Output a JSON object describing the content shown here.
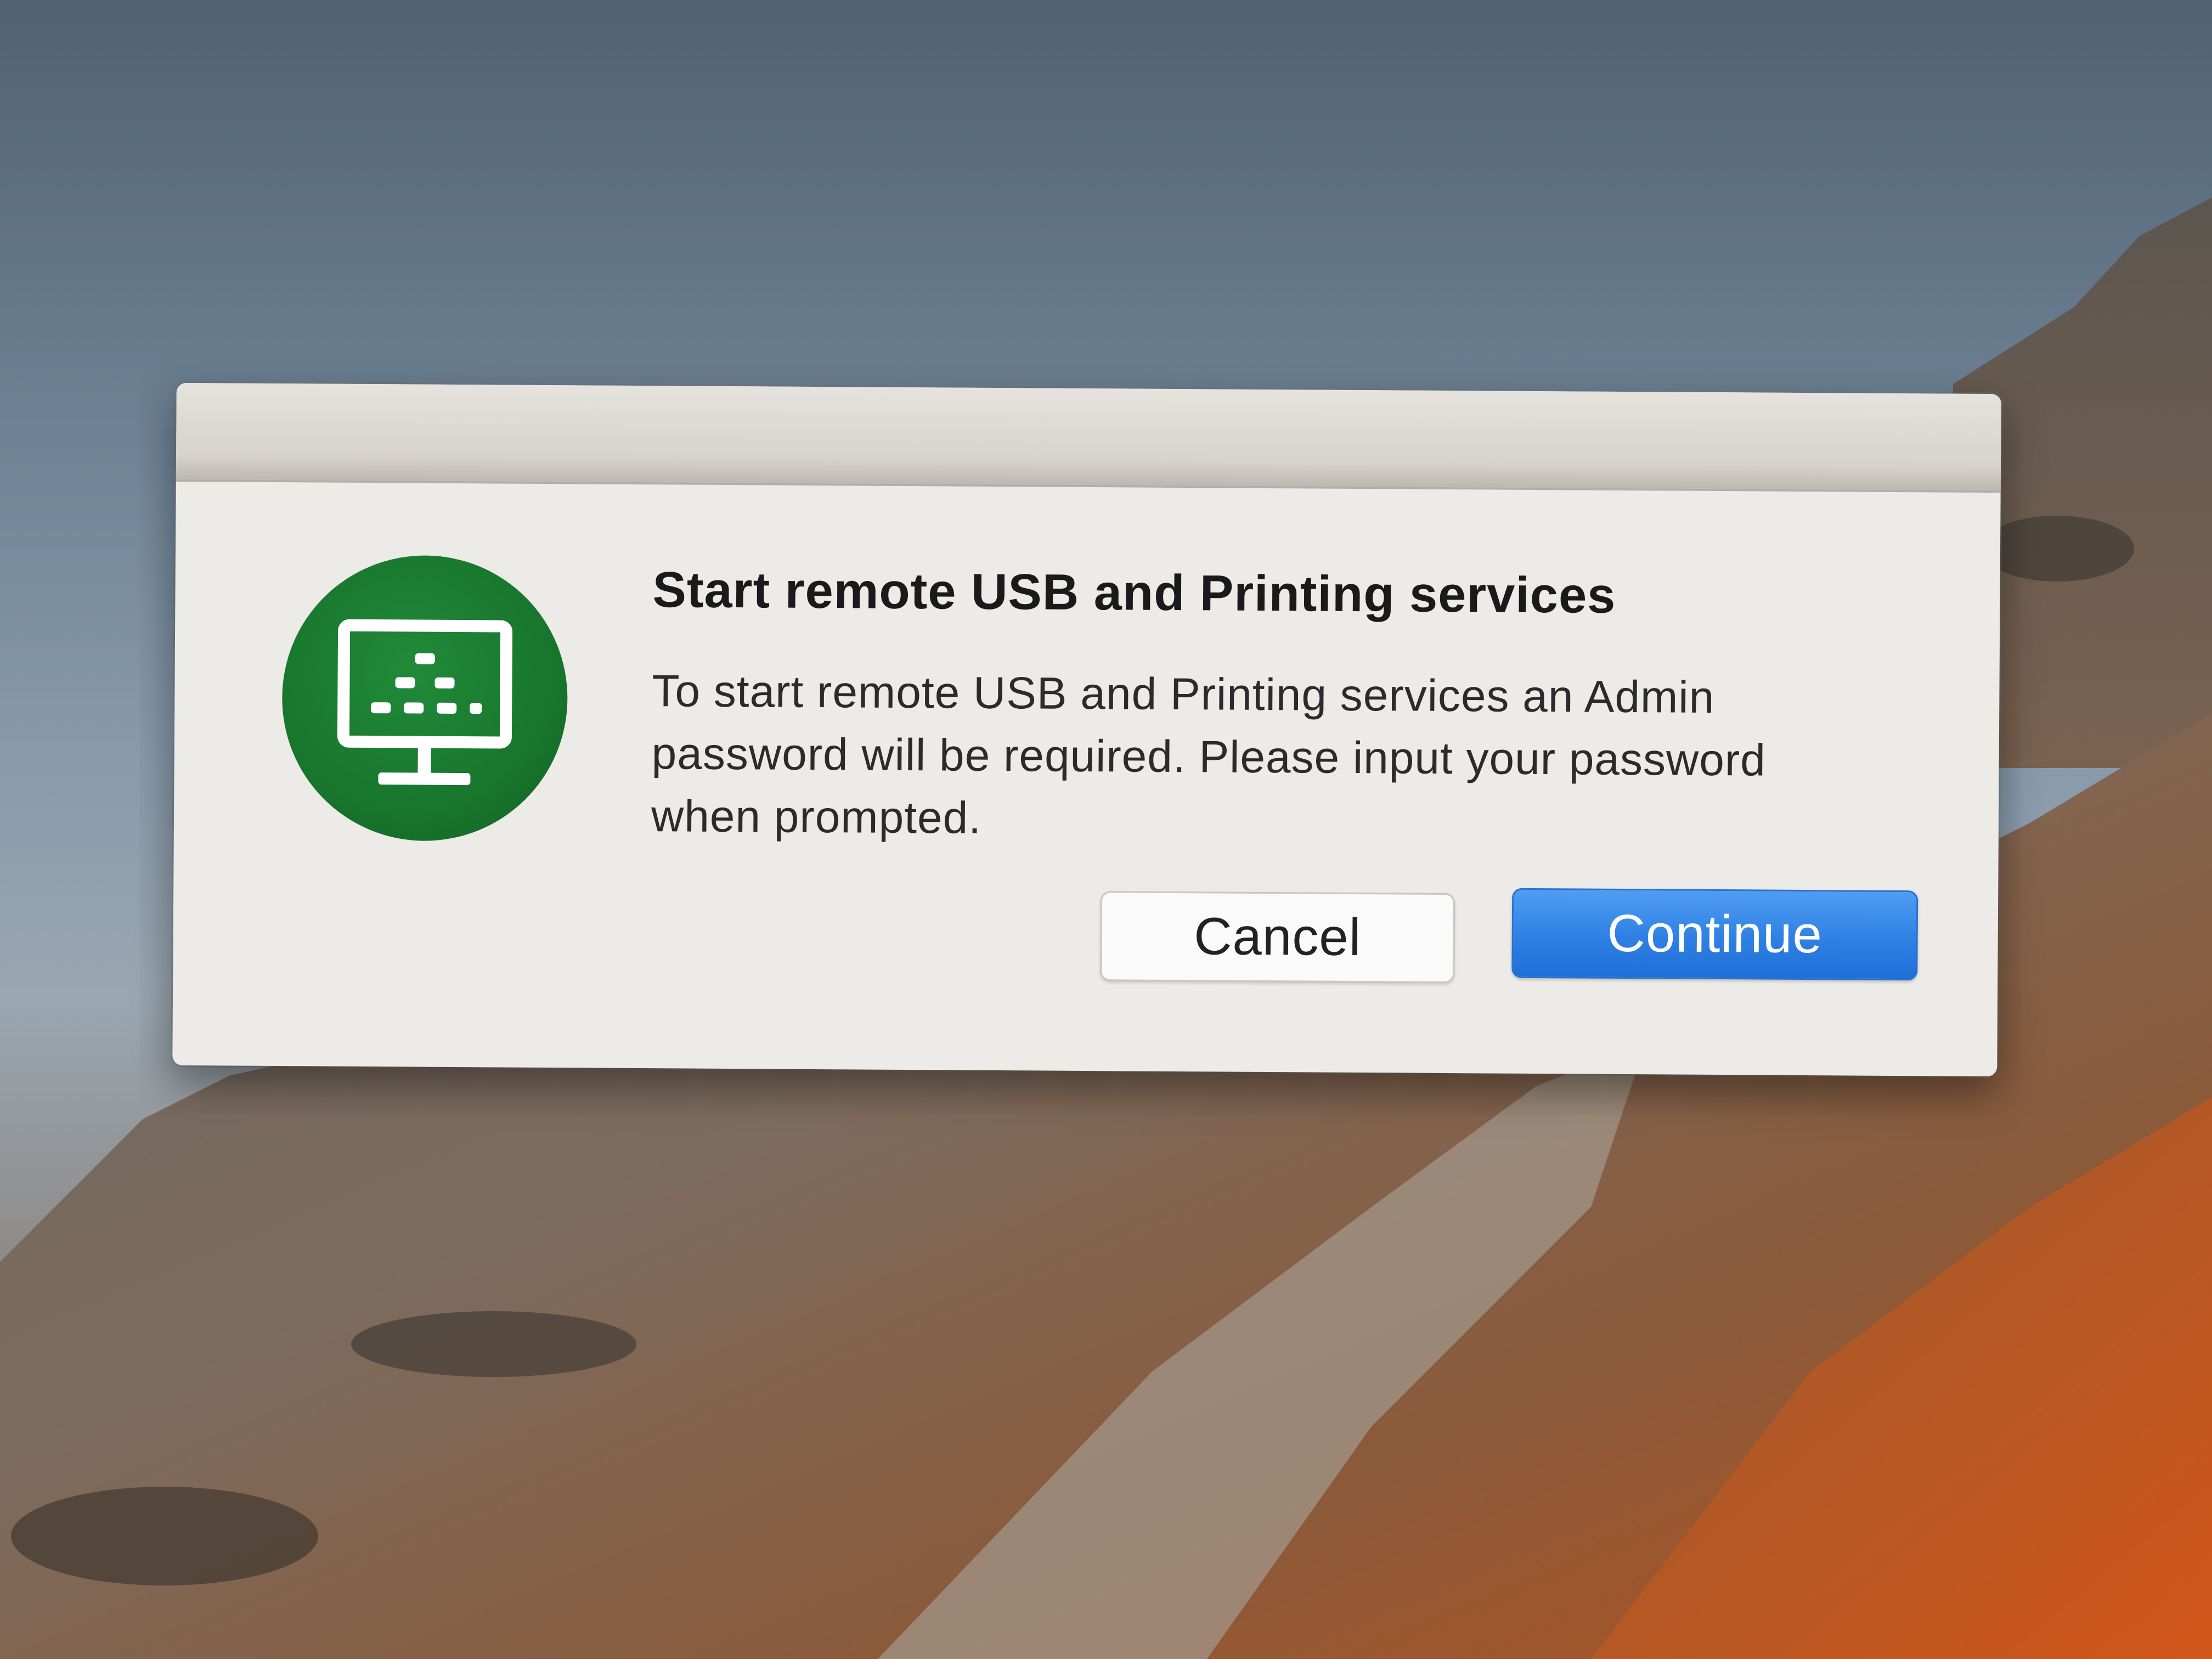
{
  "dialog": {
    "title": "Start remote USB and Printing services",
    "message": "To start remote USB and Printing services an Admin password will be required.  Please input your password when prompted.",
    "icon": "remote-usb-printing-icon",
    "icon_color": "#17742c",
    "buttons": {
      "cancel_label": "Cancel",
      "continue_label": "Continue"
    },
    "accent_color": "#2f80e4"
  },
  "desktop": {
    "wallpaper": "mountain-landscape"
  }
}
